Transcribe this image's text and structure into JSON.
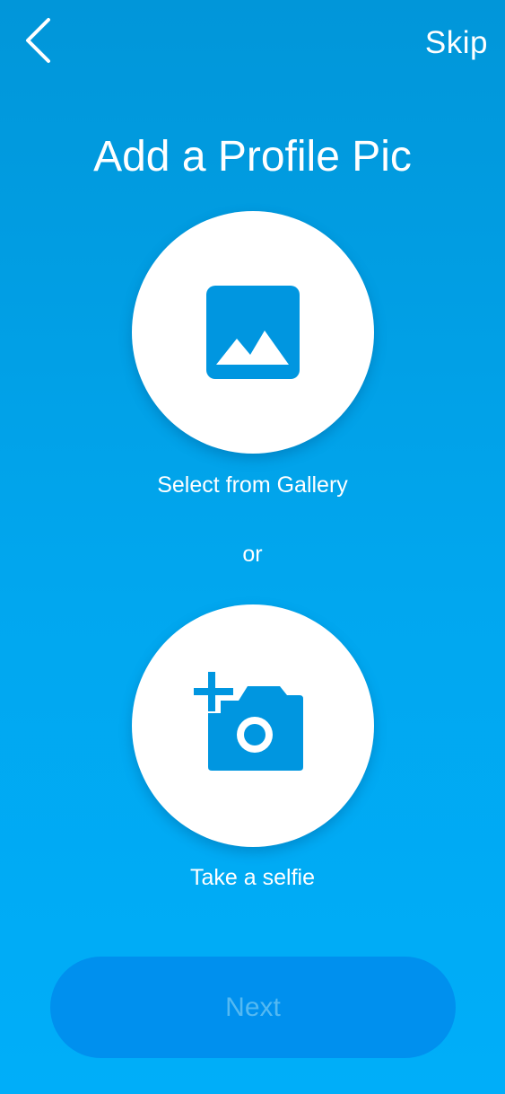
{
  "header": {
    "back_icon": "chevron-left-icon",
    "skip_label": "Skip"
  },
  "title": "Add a Profile Pic",
  "options": {
    "gallery": {
      "icon": "image-icon",
      "label": "Select from Gallery"
    },
    "separator": "or",
    "selfie": {
      "icon": "add-photo-camera-icon",
      "label": "Take a selfie"
    }
  },
  "footer": {
    "next_label": "Next",
    "next_enabled": false
  },
  "colors": {
    "background_top": "#0196d9",
    "background_bottom": "#00aef9",
    "icon_blue": "#0096e0",
    "next_button": "#0090ee",
    "next_text_disabled": "#54b9f2"
  }
}
